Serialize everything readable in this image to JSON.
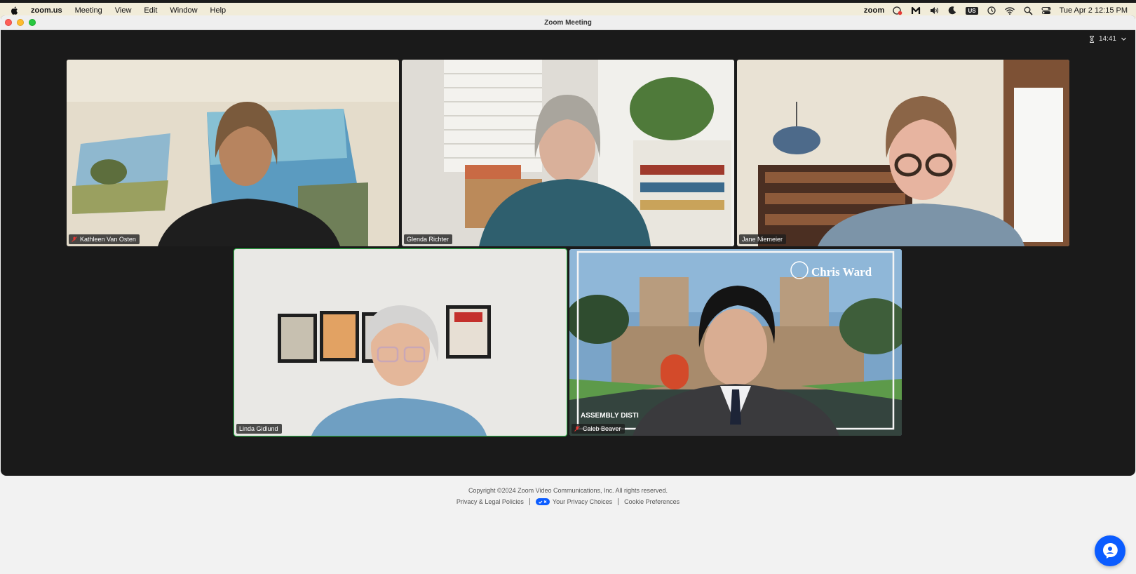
{
  "menubar": {
    "app_name": "zoom.us",
    "menus": [
      "Meeting",
      "View",
      "Edit",
      "Window",
      "Help"
    ],
    "status_logo": "zoom",
    "input_source": "US",
    "clock": "Tue Apr 2  12:15 PM",
    "icons": [
      "apple-icon",
      "zoom-status-icon",
      "malwarebytes-icon",
      "volume-icon",
      "moon-icon",
      "time-machine-icon",
      "wifi-icon",
      "spotlight-icon",
      "control-center-icon"
    ]
  },
  "window": {
    "title": "Zoom Meeting",
    "timer": "14:41"
  },
  "participants": [
    {
      "name": "Kathleen Van Osten",
      "muted": true
    },
    {
      "name": "Glenda Richter",
      "muted": false
    },
    {
      "name": "Jane Niemeier",
      "muted": false
    },
    {
      "name": "Linda Gidlund",
      "muted": false,
      "speaking": true
    },
    {
      "name": "Caleb Beaver",
      "muted": true
    }
  ],
  "background_banner": {
    "title": "Chris Ward",
    "subtitle": "ASSEMBLY DISTI"
  },
  "footer": {
    "copyright": "Copyright ©2024 Zoom Video Communications, Inc. All rights reserved.",
    "privacy_policies": "Privacy & Legal Policies",
    "privacy_choices": "Your Privacy Choices",
    "cookie_preferences": "Cookie Preferences"
  },
  "colors": {
    "window_bg": "#1a1a1a",
    "speaking_outline": "#2ec04b",
    "zoom_blue": "#0b5cff"
  }
}
